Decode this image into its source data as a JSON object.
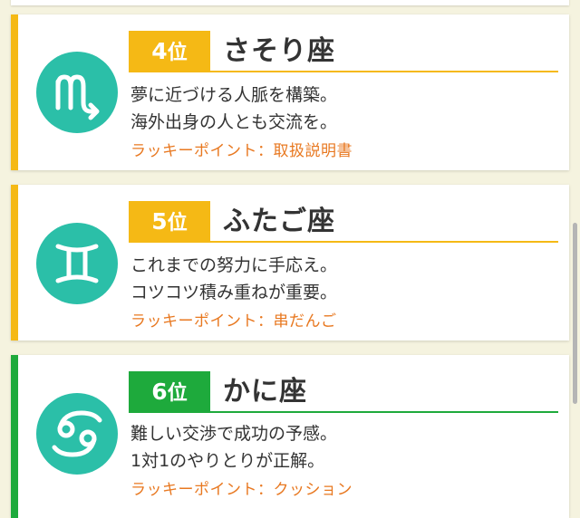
{
  "colors": {
    "yellow": "#f5b915",
    "green": "#1eaa3c",
    "teal": "#2bbfa8",
    "orange": "#e87820",
    "background": "#f5f3df"
  },
  "cards": [
    {
      "rank_number": "4",
      "rank_suffix": "位",
      "sign_name": "さそり座",
      "sign_icon": "scorpio-icon",
      "line1": "夢に近づける人脈を構築。",
      "line2": "海外出身の人とも交流を。",
      "lucky": "ラッキーポイント：取扱説明書",
      "accent": "yellow"
    },
    {
      "rank_number": "5",
      "rank_suffix": "位",
      "sign_name": "ふたご座",
      "sign_icon": "gemini-icon",
      "line1": "これまでの努力に手応え。",
      "line2": "コツコツ積み重ねが重要。",
      "lucky": "ラッキーポイント：串だんご",
      "accent": "yellow"
    },
    {
      "rank_number": "6",
      "rank_suffix": "位",
      "sign_name": "かに座",
      "sign_icon": "cancer-icon",
      "line1": "難しい交渉で成功の予感。",
      "line2": "1対1のやりとりが正解。",
      "lucky": "ラッキーポイント：クッション",
      "accent": "green"
    }
  ]
}
